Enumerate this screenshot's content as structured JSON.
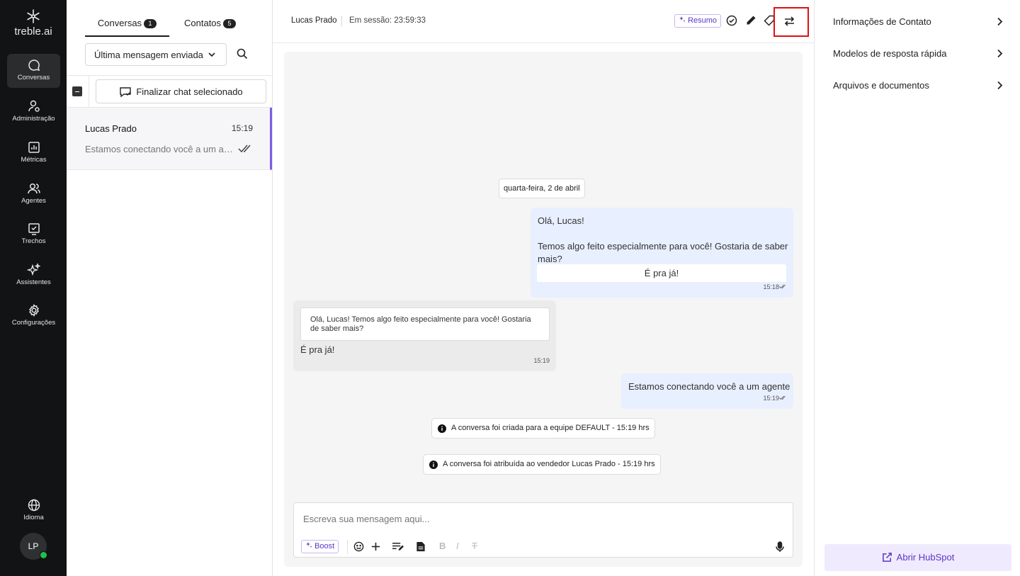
{
  "brand": {
    "name": "treble.ai"
  },
  "nav": {
    "items": [
      {
        "label": "Conversas",
        "icon": "chat-bubble-icon",
        "active": true
      },
      {
        "label": "Administração",
        "icon": "user-admin-icon"
      },
      {
        "label": "Métricas",
        "icon": "bar-chart-icon"
      },
      {
        "label": "Agentes",
        "icon": "users-icon"
      },
      {
        "label": "Trechos",
        "icon": "checkbox-icon"
      },
      {
        "label": "Assistentes",
        "icon": "sparkles-icon"
      },
      {
        "label": "Configurações",
        "icon": "gear-icon"
      }
    ],
    "language": "Idioma",
    "user_initials": "LP"
  },
  "conversations": {
    "tabs": [
      {
        "label": "Conversas",
        "count": "1"
      },
      {
        "label": "Contatos",
        "count": "5"
      }
    ],
    "sort_label": "Última mensagem enviada",
    "finalize_label": "Finalizar chat selecionado",
    "items": [
      {
        "name": "Lucas Prado",
        "time": "15:19",
        "preview": "Estamos conectando você a um agente"
      }
    ]
  },
  "chat": {
    "contact_name": "Lucas Prado",
    "session": "Em sessão: 23:59:33",
    "resumo_label": "Resumo",
    "date_divider": "quarta-feira, 2 de abril",
    "messages": {
      "out1_greeting": "Olá, Lucas!",
      "out1_body": "Temos algo feito especialmente para você! Gostaria de saber mais?",
      "out1_button": "É pra já!",
      "out1_time": "15:18",
      "in1_quote": "Olá, Lucas! Temos algo feito especialmente para você! Gostaria de saber mais?",
      "in1_reply": "É pra já!",
      "in1_time": "15:19",
      "out2_text": "Estamos conectando você a um agente",
      "out2_time": "15:19"
    },
    "system": [
      "A conversa foi criada para a equipe DEFAULT - 15:19 hrs",
      "A conversa foi atribuída ao vendedor Lucas Prado - 15:19 hrs"
    ],
    "composer": {
      "placeholder": "Escreva sua mensagem aqui...",
      "boost_label": "Boost"
    }
  },
  "right_panel": {
    "items": [
      "Informações de Contato",
      "Modelos de resposta rápida",
      "Arquivos e documentos"
    ],
    "hubspot_label": "Abrir HubSpot"
  },
  "colors": {
    "nav_bg": "#121314",
    "accent": "#7e5ce6",
    "outgoing_bubble": "#e8efff",
    "highlight": "#e01010",
    "online": "#1fc14b"
  }
}
